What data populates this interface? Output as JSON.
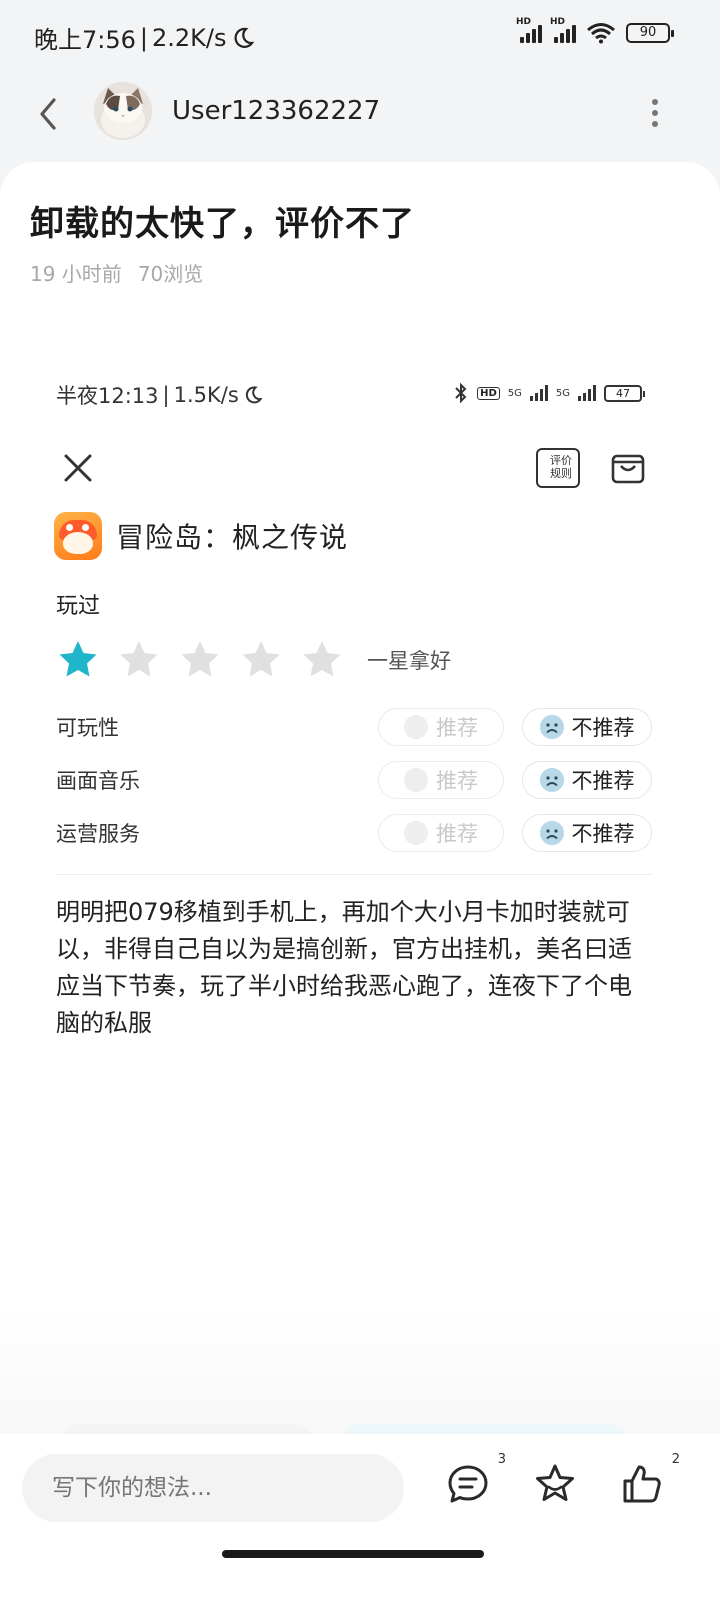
{
  "status_bar": {
    "time": "晚上7:56",
    "speed": "2.2K/s",
    "battery": "90",
    "hd_label": "HD"
  },
  "header": {
    "username": "User123362227"
  },
  "post": {
    "title": "卸载的太快了，评价不了",
    "time_ago": "19 小时前",
    "views": "70浏览"
  },
  "screenshot": {
    "status_time": "半夜12:13",
    "status_speed": "1.5K/s",
    "battery": "47",
    "hd_label": "HD",
    "net1": "5G",
    "net2": "5G",
    "rules_label_1": "评价",
    "rules_label_2": "规则",
    "game_name": "冒险岛：枫之传说",
    "played_label": "玩过",
    "rating": 1,
    "rating_max": 5,
    "rating_text": "一星拿好",
    "star_color_active": "#1fb6c9",
    "star_color_inactive": "#e0e0e0",
    "criteria": [
      {
        "label": "可玩性",
        "recommend": "推荐",
        "not_recommend": "不推荐"
      },
      {
        "label": "画面音乐",
        "recommend": "推荐",
        "not_recommend": "不推荐"
      },
      {
        "label": "运营服务",
        "recommend": "推荐",
        "not_recommend": "不推荐"
      }
    ],
    "review_text": "明明把079移植到手机上，再加个大小月卡加时装就可以，非得自己自以为是搞创新，官方出挂机，美名曰适应当下节奏，玩了半小时给我恶心跑了，连夜下了个电脑的私服"
  },
  "bottom": {
    "comment_placeholder": "写下你的想法...",
    "comment_count": "3",
    "like_count": "2"
  }
}
